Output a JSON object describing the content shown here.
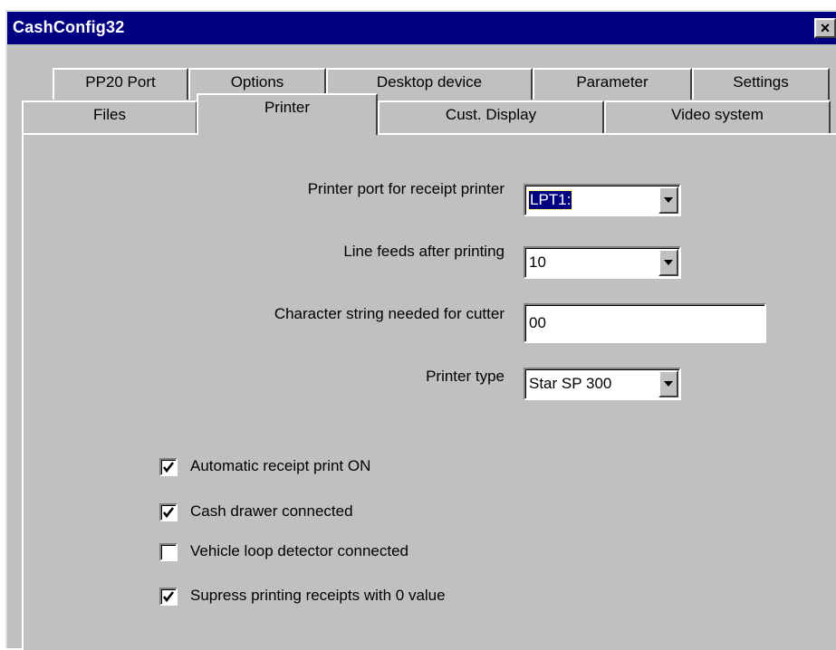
{
  "window": {
    "title": "CashConfig32",
    "close_glyph": "×"
  },
  "tabs": {
    "row_back": [
      "PP20 Port",
      "Options",
      "Desktop device",
      "Parameter",
      "Settings"
    ],
    "row_front": [
      "Files",
      "Printer",
      "Cust. Display",
      "Video system"
    ],
    "active": "Printer"
  },
  "form": {
    "printer_port_label": "Printer port for receipt printer",
    "printer_port_value": "LPT1:",
    "line_feeds_label": "Line feeds after printing",
    "line_feeds_value": "10",
    "cutter_label": "Character string needed for cutter",
    "cutter_value": "00",
    "printer_type_label": "Printer type",
    "printer_type_value": "Star SP 300"
  },
  "checkboxes": [
    {
      "label": "Automatic receipt print ON",
      "checked": true
    },
    {
      "label": "Cash drawer connected",
      "checked": true
    },
    {
      "label": "Vehicle loop detector connected",
      "checked": false
    },
    {
      "label": "Supress printing receipts with 0 value",
      "checked": true
    }
  ],
  "icons": {
    "dropdown": "chevron-down-icon",
    "check": "check-mark-icon"
  },
  "colors": {
    "titlebar": "#000080",
    "face": "#c0c0c0",
    "selection": "#000080"
  }
}
